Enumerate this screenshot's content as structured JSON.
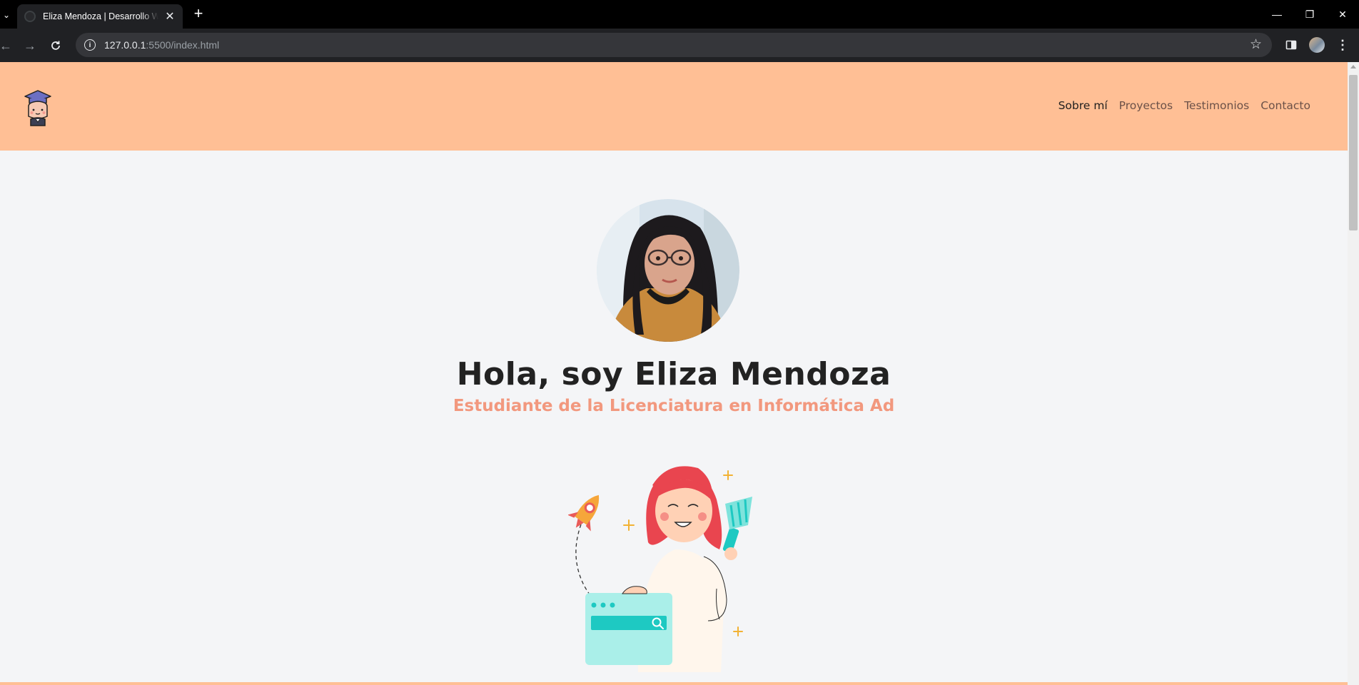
{
  "browser": {
    "tab_title": "Eliza Mendoza | Desarrollo Web",
    "url_host": "127.0.0.1",
    "url_path": ":5500/index.html"
  },
  "site": {
    "nav": [
      {
        "label": "Sobre mí",
        "active": true
      },
      {
        "label": "Proyectos",
        "active": false
      },
      {
        "label": "Testimonios",
        "active": false
      },
      {
        "label": "Contacto",
        "active": false
      }
    ],
    "hero_title": "Hola, soy Eliza Mendoza",
    "hero_subtitle": "Estudiante de la Licenciatura en Informática Ad"
  },
  "colors": {
    "header_bg": "#ffbf95",
    "subtitle": "#f2987e",
    "page_bg": "#f4f5f7"
  },
  "icons": [
    "graduate-logo-icon",
    "rocket-icon",
    "search-icon",
    "paint-brush-icon",
    "star-icon",
    "reload-icon"
  ]
}
